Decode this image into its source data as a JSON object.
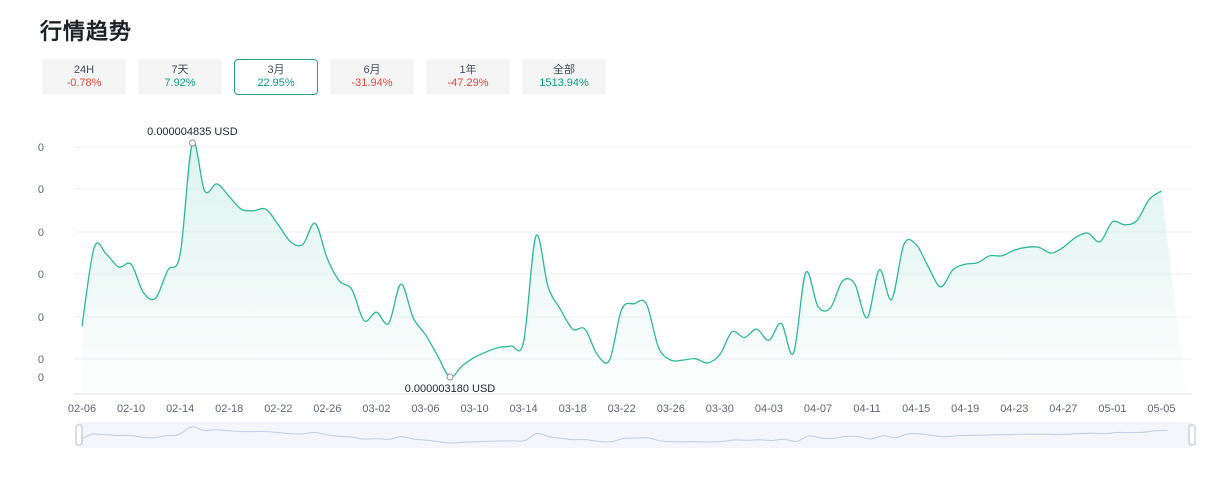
{
  "header": {
    "title": "行情趋势"
  },
  "tabs": [
    {
      "label": "24H",
      "change": "-0.78%",
      "dir": "down",
      "active": false
    },
    {
      "label": "7天",
      "change": "7.92%",
      "dir": "up",
      "active": false
    },
    {
      "label": "3月",
      "change": "22.95%",
      "dir": "up",
      "active": true
    },
    {
      "label": "6月",
      "change": "-31.94%",
      "dir": "down",
      "active": false
    },
    {
      "label": "1年",
      "change": "-47.29%",
      "dir": "down",
      "active": false
    },
    {
      "label": "全部",
      "change": "1513.94%",
      "dir": "up",
      "active": false
    }
  ],
  "chart_data": {
    "type": "area",
    "x": [
      "02-06",
      "02-07",
      "02-08",
      "02-09",
      "02-10",
      "02-11",
      "02-12",
      "02-13",
      "02-14",
      "02-15",
      "02-16",
      "02-17",
      "02-18",
      "02-19",
      "02-20",
      "02-21",
      "02-22",
      "02-23",
      "02-24",
      "02-25",
      "02-26",
      "02-27",
      "02-28",
      "03-01",
      "03-02",
      "03-03",
      "03-04",
      "03-05",
      "03-06",
      "03-07",
      "03-08",
      "03-09",
      "03-10",
      "03-11",
      "03-12",
      "03-13",
      "03-14",
      "03-15",
      "03-16",
      "03-17",
      "03-18",
      "03-19",
      "03-20",
      "03-21",
      "03-22",
      "03-23",
      "03-24",
      "03-25",
      "03-26",
      "03-27",
      "03-28",
      "03-29",
      "03-30",
      "03-31",
      "04-01",
      "04-02",
      "04-03",
      "04-04",
      "04-05",
      "04-06",
      "04-07",
      "04-08",
      "04-09",
      "04-10",
      "04-11",
      "04-12",
      "04-13",
      "04-14",
      "04-15",
      "04-16",
      "04-17",
      "04-18",
      "04-19",
      "04-20",
      "04-21",
      "04-22",
      "04-23",
      "04-24",
      "04-25",
      "04-26",
      "04-27",
      "04-28",
      "04-29",
      "04-30",
      "05-01",
      "05-02",
      "05-03",
      "05-04",
      "05-05",
      "05-06",
      "05-07"
    ],
    "values": [
      3.54e-06,
      4.1e-06,
      4.05e-06,
      3.96e-06,
      3.98e-06,
      3.78e-06,
      3.74e-06,
      3.94e-06,
      4.05e-06,
      4.84e-06,
      4.5e-06,
      4.55e-06,
      4.46e-06,
      4.37e-06,
      4.36e-06,
      4.37e-06,
      4.26e-06,
      4.14e-06,
      4.12e-06,
      4.27e-06,
      4.02e-06,
      3.86e-06,
      3.8e-06,
      3.58e-06,
      3.64e-06,
      3.56e-06,
      3.84e-06,
      3.6e-06,
      3.48e-06,
      3.33e-06,
      3.18e-06,
      3.26e-06,
      3.32e-06,
      3.36e-06,
      3.39e-06,
      3.4e-06,
      3.43e-06,
      4.18e-06,
      3.82e-06,
      3.66e-06,
      3.52e-06,
      3.52e-06,
      3.34e-06,
      3.3e-06,
      3.66e-06,
      3.7e-06,
      3.7e-06,
      3.39e-06,
      3.3e-06,
      3.3e-06,
      3.31e-06,
      3.28e-06,
      3.34e-06,
      3.5e-06,
      3.46e-06,
      3.52e-06,
      3.44e-06,
      3.56e-06,
      3.35e-06,
      3.92e-06,
      3.68e-06,
      3.67e-06,
      3.86e-06,
      3.84e-06,
      3.6e-06,
      3.94e-06,
      3.73e-06,
      4.12e-06,
      4.12e-06,
      3.96e-06,
      3.82e-06,
      3.94e-06,
      3.98e-06,
      3.99e-06,
      4.04e-06,
      4.04e-06,
      4.08e-06,
      4.1e-06,
      4.1e-06,
      4.06e-06,
      4.1e-06,
      4.17e-06,
      4.2e-06,
      4.14e-06,
      4.28e-06,
      4.26e-06,
      4.29e-06,
      4.44e-06,
      4.5e-06
    ],
    "xticks": [
      "02-06",
      "02-10",
      "02-14",
      "02-18",
      "02-22",
      "02-26",
      "03-02",
      "03-06",
      "03-10",
      "03-14",
      "03-18",
      "03-22",
      "03-26",
      "03-30",
      "04-03",
      "04-07",
      "04-11",
      "04-15",
      "04-19",
      "04-23",
      "04-27",
      "05-01",
      "05-05"
    ],
    "ytick_labels": [
      "0",
      "0",
      "0",
      "0",
      "0",
      "0",
      "0"
    ],
    "ylim": [
      3.1e-06,
      4.9e-06
    ],
    "max_annotation": {
      "index": 9,
      "label": "0.000004835 USD"
    },
    "min_annotation": {
      "index": 30,
      "label": "0.000003180 USD"
    },
    "line_color": "#2eb897",
    "fill_color": "#2eb897",
    "grid": true
  }
}
